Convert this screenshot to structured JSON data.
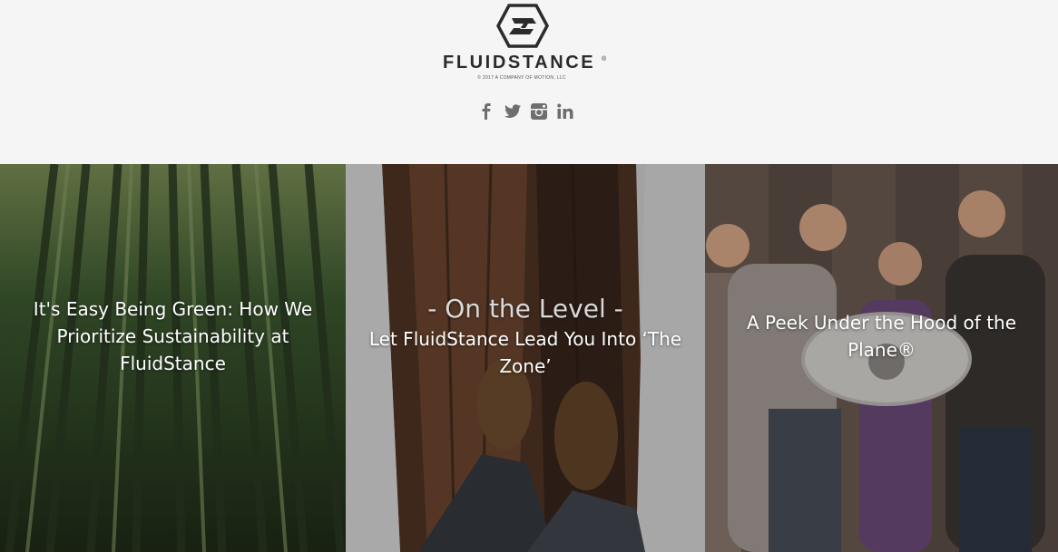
{
  "brand": {
    "name": "FLUIDSTANCE",
    "registered": "®",
    "copyright": "© 2017 A COMPANY OF MOTION, LLC"
  },
  "social": [
    {
      "name": "facebook-icon",
      "glyph": "f"
    },
    {
      "name": "twitter-icon",
      "glyph": "t"
    },
    {
      "name": "instagram-icon",
      "glyph": "ig"
    },
    {
      "name": "linkedin-icon",
      "glyph": "in"
    }
  ],
  "tiles": [
    {
      "title": "It's Easy Being Green: How We Prioritize Sustainability at FluidStance"
    },
    {
      "kicker": "- On the Level -",
      "title": "Let FluidStance Lead You Into ‘The Zone’"
    },
    {
      "title": "A Peek Under the Hood of the Plane®"
    }
  ],
  "colors": {
    "header_bg": "#f5f5f5",
    "logo": "#2b2b2b",
    "icon": "#6e6e6e"
  }
}
